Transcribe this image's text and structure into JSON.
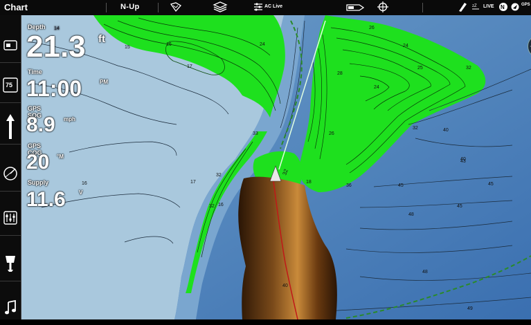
{
  "topbar": {
    "title": "Chart",
    "orientation": "N-Up",
    "ac_live": "AC Live",
    "live": "LIVE",
    "gps": "GPS"
  },
  "overlay": {
    "depth_label": "Depth",
    "depth_value": "21.3",
    "depth_unit": "ft",
    "depth_scale": "14",
    "time_label": "Time",
    "time_value": "11:00",
    "time_ampm": "PM",
    "sog_label": "GPS SOG",
    "sog_value": "8.9",
    "sog_unit": "mph",
    "cog_label": "GPS COG",
    "cog_value": "20",
    "cog_unit": "°M",
    "supply_label": "Supply",
    "supply_value": "11.6",
    "supply_unit": "V"
  },
  "sidebar_icons": [
    "chart-view-icon",
    "water-temp-75-icon",
    "navigation-arrow-icon",
    "sonar-icon",
    "settings-sliders-icon",
    "trolling-motor-icon",
    "music-icon"
  ],
  "sidebar_temp": "75",
  "contour_labels": [
    "15",
    "16",
    "17",
    "17",
    "16",
    "24",
    "26",
    "28",
    "24",
    "25",
    "24",
    "32",
    "26",
    "40",
    "32",
    "40",
    "43",
    "36",
    "45",
    "45",
    "48",
    "45",
    "48",
    "40",
    "49",
    "18",
    "32",
    "32",
    "33",
    "16"
  ],
  "colors": {
    "water_shallow": "#a9c8dd",
    "water_mid": "#6c9cc8",
    "water_deep": "#3f75b5",
    "green": "#1ee01e",
    "sonar": "#8a5520"
  }
}
